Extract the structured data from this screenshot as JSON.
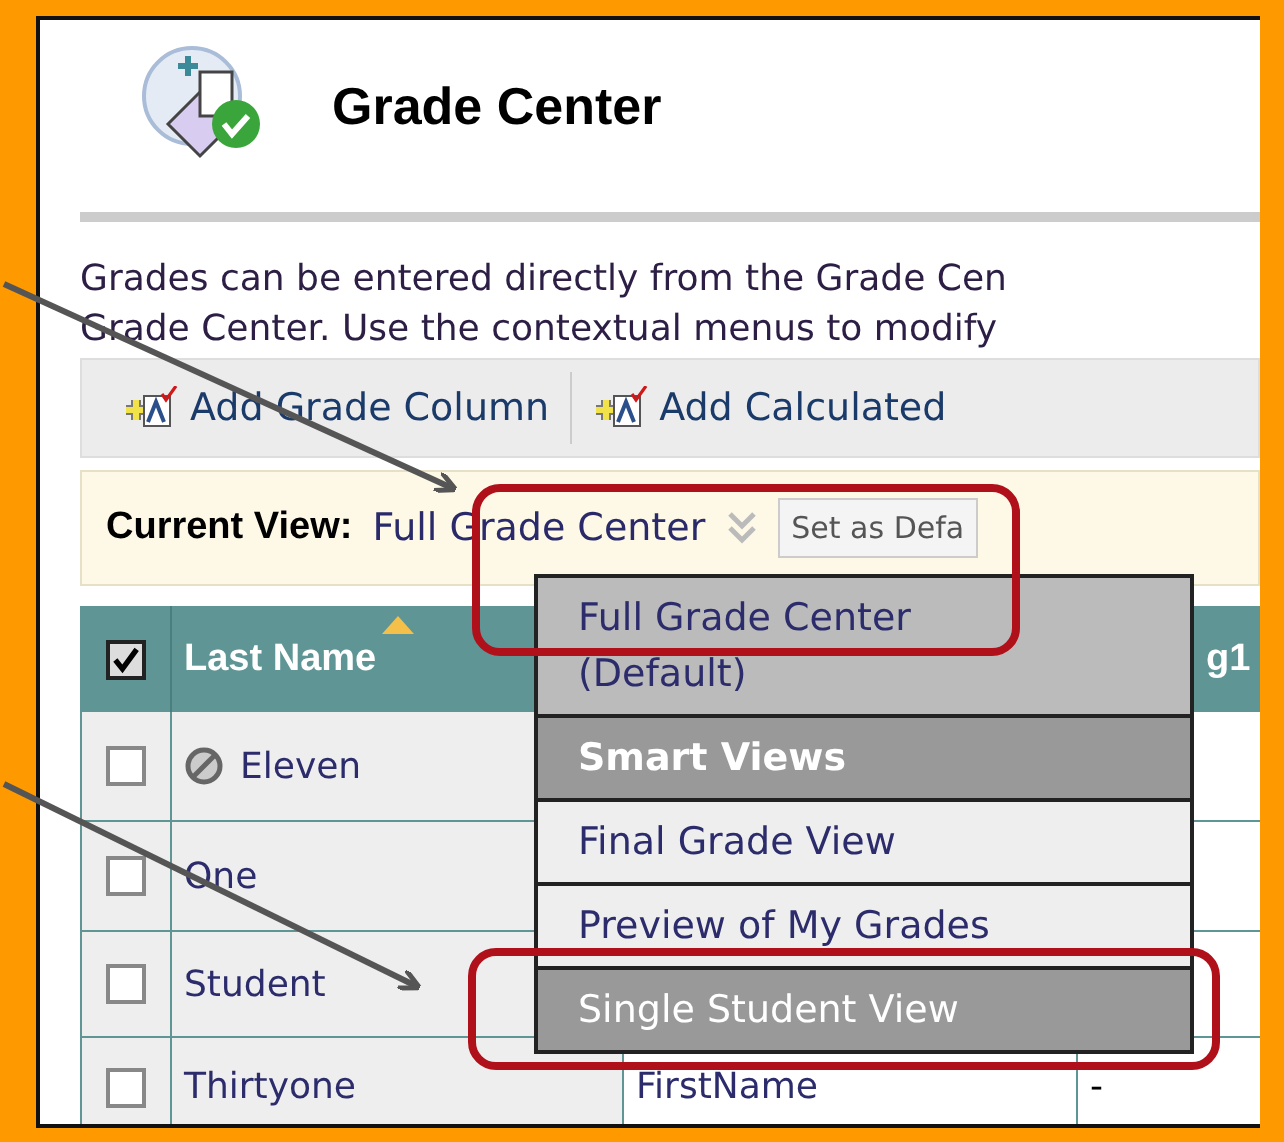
{
  "header": {
    "title": "Grade Center"
  },
  "description": [
    "Grades can be entered directly from the Grade Cen",
    "Grade Center. Use the contextual menus to modify"
  ],
  "toolbar": [
    {
      "label": "Add Grade Column"
    },
    {
      "label": "Add Calculated"
    }
  ],
  "current_view": {
    "label": "Current View:",
    "value": "Full Grade Center",
    "set_default": "Set as Defa"
  },
  "table": {
    "select_all_checked": true,
    "columns": [
      {
        "label": "Last Name",
        "sorted": true
      },
      {
        "label": "g1",
        "sorted": false
      }
    ],
    "rows": [
      {
        "checked": false,
        "unavailable": true,
        "last_name": "Eleven"
      },
      {
        "checked": false,
        "unavailable": false,
        "last_name": "One"
      },
      {
        "checked": false,
        "unavailable": false,
        "last_name": "Student"
      },
      {
        "checked": false,
        "unavailable": false,
        "last_name": "Thirtyone",
        "first_name": "FirstName",
        "column_3": "-"
      }
    ]
  },
  "view_menu": [
    {
      "kind": "option",
      "label": "Full Grade Center (Default)",
      "selected": true,
      "hovered": false
    },
    {
      "kind": "heading",
      "label": "Smart Views"
    },
    {
      "kind": "option",
      "label": "Final Grade View",
      "selected": false,
      "hovered": false
    },
    {
      "kind": "option",
      "label": "Preview of My Grades",
      "selected": false,
      "hovered": false
    },
    {
      "kind": "option",
      "label": "Single Student View",
      "selected": false,
      "hovered": true
    }
  ]
}
